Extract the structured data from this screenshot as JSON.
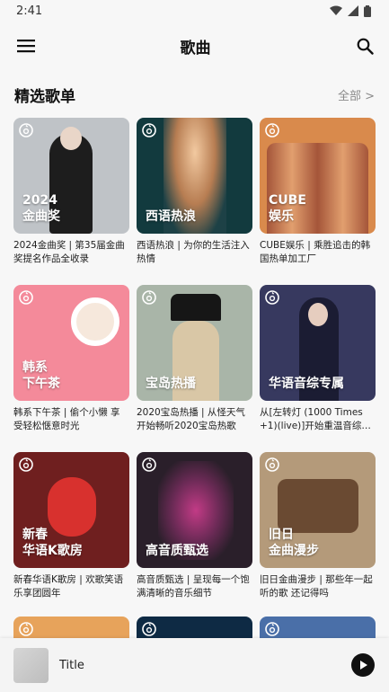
{
  "status_bar": {
    "time": "2:41"
  },
  "app_bar": {
    "title": "歌曲"
  },
  "section": {
    "title": "精选歌单",
    "see_all": "全部 >"
  },
  "playlists": [
    {
      "cover_text": "2024\n金曲奖",
      "caption": "2024金曲奖 | 第35届金曲奖提名作品全收录",
      "bg": "#bfc3c7"
    },
    {
      "cover_text": "西语热浪",
      "caption": "西语热浪 | 为你的生活注入热情",
      "bg": "#123a3e"
    },
    {
      "cover_text": "CUBE\n娱乐",
      "caption": "CUBE娱乐 | 乘胜追击的韩国热单加工厂",
      "bg": "#d98a4c"
    },
    {
      "cover_text": "韩系\n下午茶",
      "caption": "韩系下午茶 | 偷个小懒 享受轻松惬意时光",
      "bg": "#f48a9a"
    },
    {
      "cover_text": "宝岛热播",
      "caption": "2020宝岛热播 | 从怪天气开始畅听2020宝岛热歌",
      "bg": "#a9b5a8"
    },
    {
      "cover_text": "华语音综专属",
      "caption": "从[左转灯 (1000 Times +1)(live)]开始重温音综…",
      "bg": "#37395f"
    },
    {
      "cover_text": "新春\n华语K歌房",
      "caption": "新春华语K歌房 | 欢歌笑语 乐享团圆年",
      "bg": "#6f1f1f"
    },
    {
      "cover_text": "高音质甄选",
      "caption": "高音质甄选 | 呈现每一个饱满清晰的音乐细节",
      "bg": "#2a1f2a"
    },
    {
      "cover_text": "旧日\n金曲漫步",
      "caption": "旧日金曲漫步 | 那些年一起听的歌 还记得吗",
      "bg": "#b49a7a"
    }
  ],
  "partial_covers": [
    {
      "bg": "#e7a35b"
    },
    {
      "bg": "#0e2a44"
    },
    {
      "bg": "#4a6fa8"
    }
  ],
  "player": {
    "title": "Title"
  },
  "colors": {
    "accent": "#111111",
    "muted": "#8a8a8a",
    "background": "#f7f7f7"
  },
  "icons": {
    "menu": "menu-icon",
    "search": "search-icon",
    "play": "play-icon",
    "badge": "netease-badge-icon"
  }
}
